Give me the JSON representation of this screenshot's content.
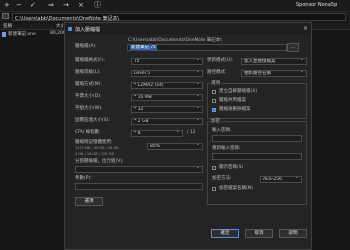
{
  "toolbar": {
    "profile_label": "Sponsor Nona5p"
  },
  "path_bar": {
    "value": "C:\\Users\\abb\\Documents\\OneNote 筆記本\\"
  },
  "file_list": {
    "header_name": "名稱",
    "header_size": "大小",
    "items": [
      {
        "name": "新建筆記.one",
        "size": "80,200"
      }
    ]
  },
  "dialog": {
    "title": "加入壓縮檔",
    "archive_label": "壓縮檔(A):",
    "archive_path": "C:\\Users\\abb\\Documents\\OneNote 筆記本\\",
    "archive_name": "新建筆記.7z",
    "browse_label": "...",
    "left_rows": [
      {
        "label": "壓縮檔格式(F):",
        "value": "7z"
      },
      {
        "label": "壓縮等級(L):",
        "value": "Level 5"
      },
      {
        "label": "壓縮方式(M):",
        "value": "* LZMA2 (x4)"
      },
      {
        "label": "字典大小(D):",
        "value": "* 16 MB"
      },
      {
        "label": "字組大小(W):",
        "value": "* 32"
      },
      {
        "label": "固實區塊大小(S):",
        "value": "* 2 GB"
      },
      {
        "label": "CPU 線程數:",
        "value": "* 8",
        "suffix": "/ 12"
      },
      {
        "label": "壓縮時記憶體使用:",
        "value": "80%"
      }
    ],
    "memory_lines": [
      "1470 MB / 30 GB / 16 GB",
      "4 GB / 16 GB / 128 GB"
    ],
    "split_label": "分割壓縮檔，位元組(V):",
    "params_label": "參數(P):",
    "options_button": "選項",
    "update_label": "更新模式(U):",
    "update_value": "加入並替換檔案",
    "path_mode_label": "路徑模式:",
    "path_mode_value": "相對路徑名稱",
    "options_group_title": "選項",
    "options": [
      {
        "label": "建立自解壓縮檔(X)",
        "checked": false
      },
      {
        "label": "壓縮共用檔案",
        "checked": false
      },
      {
        "label": "壓縮後刪除檔案",
        "checked": true
      }
    ],
    "encryption_group_title": "加密",
    "password_label": "輸入密碼:",
    "reenter_label": "重新輸入密碼:",
    "show_password_label": "顯示密碼(S)",
    "encrypt_method_label": "加密方法:",
    "encrypt_method_value": "AES-256",
    "encrypt_names_label": "加密檔案名稱(N)",
    "ok_button": "確定",
    "cancel_button": "取消",
    "help_button": "說明"
  }
}
